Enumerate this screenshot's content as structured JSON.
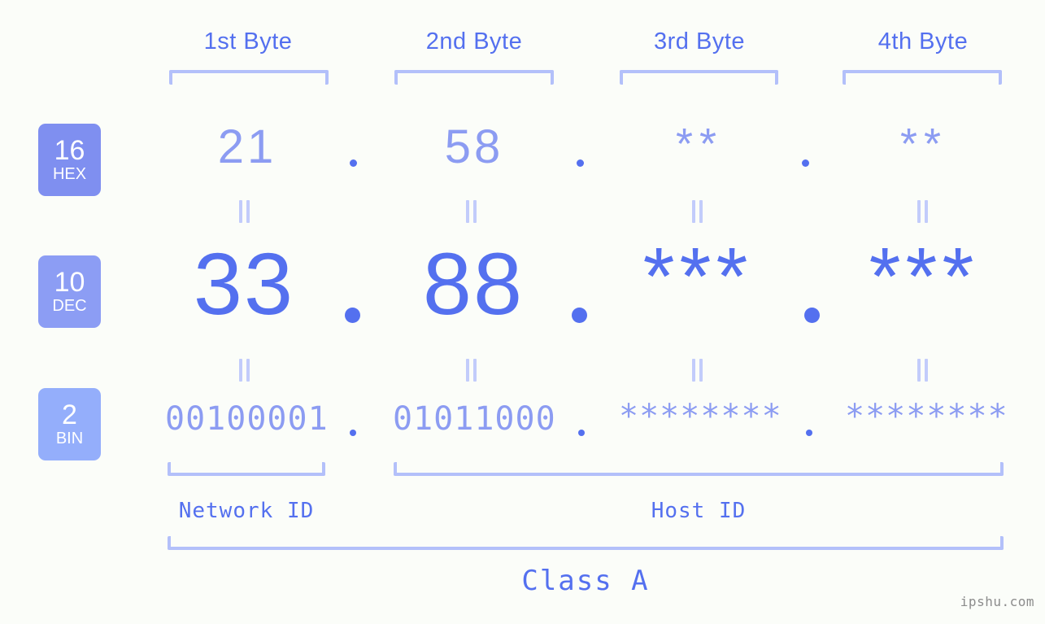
{
  "watermark": "ipshu.com",
  "byte_headers": [
    {
      "label": "1st Byte"
    },
    {
      "label": "2nd Byte"
    },
    {
      "label": "3rd Byte"
    },
    {
      "label": "4th Byte"
    }
  ],
  "bases": [
    {
      "num": "16",
      "abbr": "HEX"
    },
    {
      "num": "10",
      "abbr": "DEC"
    },
    {
      "num": "2",
      "abbr": "BIN"
    }
  ],
  "rows": {
    "hex": {
      "base_num": "16",
      "base_abbr": "HEX",
      "values": [
        "21",
        "58",
        "**",
        "**"
      ],
      "separator": "."
    },
    "dec": {
      "base_num": "10",
      "base_abbr": "DEC",
      "values": [
        "33",
        "88",
        "***",
        "***"
      ],
      "separator": "."
    },
    "bin": {
      "base_num": "2",
      "base_abbr": "BIN",
      "values": [
        "00100001",
        "01011000",
        "********",
        "********"
      ],
      "separator": "."
    }
  },
  "sections": {
    "network_id": "Network ID",
    "host_id": "Host ID",
    "class": "Class A"
  },
  "colors": {
    "background": "#fbfdf9",
    "accent_strong": "#5470ef",
    "accent_light": "#8c9cf2",
    "bracket": "#b3c0fa",
    "badge_hex": "#7f8ff0",
    "badge_dec": "#8c9df4",
    "badge_bin": "#94aefb",
    "equals": "#c2ccfb",
    "watermark": "#8c8c8c"
  }
}
